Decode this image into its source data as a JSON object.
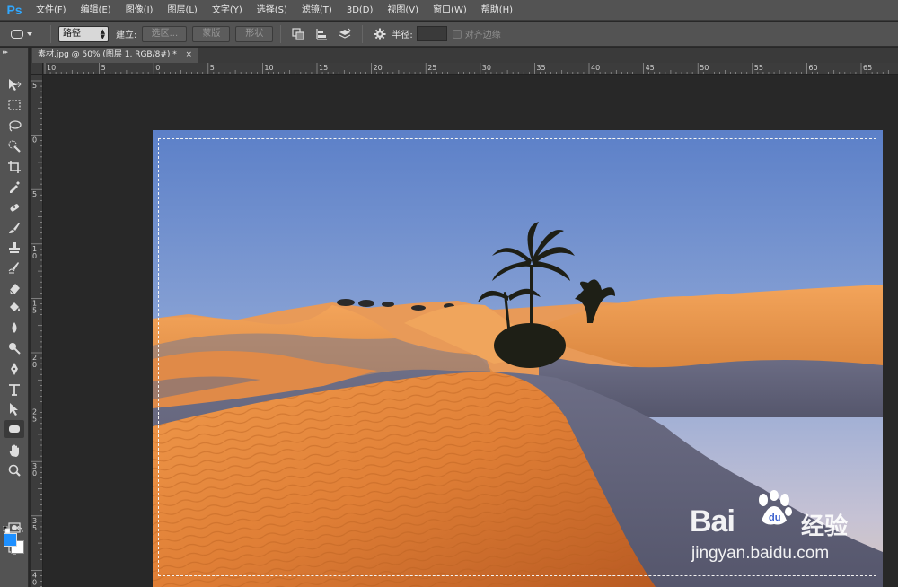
{
  "app": {
    "logo": "Ps"
  },
  "menu": [
    "文件(F)",
    "编辑(E)",
    "图像(I)",
    "图层(L)",
    "文字(Y)",
    "选择(S)",
    "滤镜(T)",
    "3D(D)",
    "视图(V)",
    "窗口(W)",
    "帮助(H)"
  ],
  "options": {
    "mode_value": "路径",
    "make_label": "建立:",
    "selection_btn": "选区...",
    "mask_btn": "蒙版",
    "shape_btn": "形状",
    "radius_label": "半径:",
    "radius_value": "",
    "align_edges_label": "对齐边缘",
    "align_edges_checked": false
  },
  "document": {
    "tab_title": "素材.jpg @ 50% (图层 1, RGB/8#) *",
    "close_glyph": "×"
  },
  "rulers": {
    "top": [
      "10",
      "5",
      "0",
      "5",
      "10",
      "15",
      "20",
      "25",
      "30",
      "35",
      "40",
      "45",
      "50",
      "55",
      "60",
      "65"
    ],
    "left": [
      "5",
      "0",
      "5",
      "1\n0",
      "1\n5",
      "2\n0",
      "2\n5",
      "3\n0",
      "3\n5",
      "4\n0"
    ]
  },
  "colors": {
    "foreground": "#1e90ff",
    "background": "#ffffff"
  },
  "tools": [
    "move-tool",
    "marquee-tool",
    "lasso-tool",
    "quick-select-tool",
    "crop-tool",
    "eyedropper-tool",
    "healing-brush-tool",
    "brush-tool",
    "clone-stamp-tool",
    "history-brush-tool",
    "eraser-tool",
    "paint-bucket-tool",
    "blur-tool",
    "dodge-tool",
    "pen-tool",
    "type-tool",
    "path-select-tool",
    "rounded-rectangle-tool",
    "hand-tool",
    "zoom-tool",
    "quick-mask-tool",
    "screen-mode-tool"
  ],
  "watermark": {
    "brand": "Bai",
    "brand_suffix": "du",
    "cn": "经验",
    "url": "jingyan.baidu.com"
  }
}
